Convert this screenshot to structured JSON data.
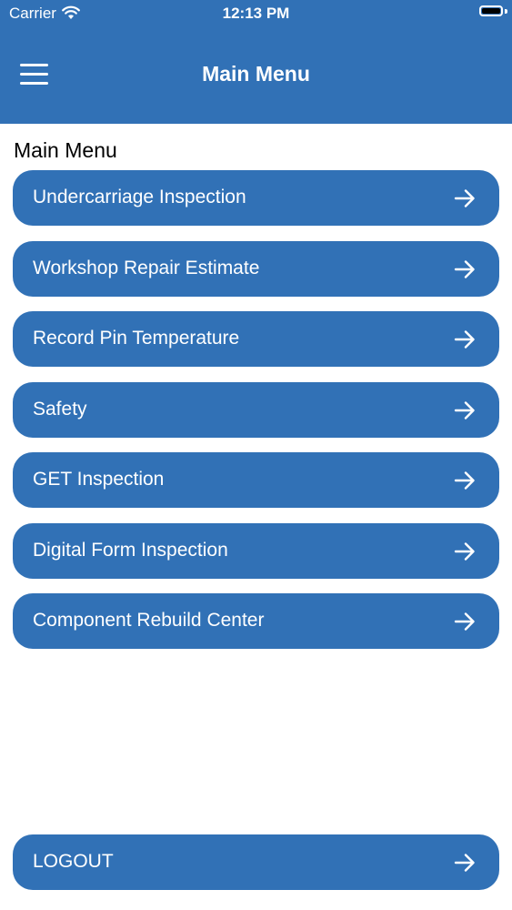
{
  "status_bar": {
    "carrier": "Carrier",
    "time": "12:13 PM",
    "wifi_icon": "wifi-icon",
    "battery_icon": "battery-icon"
  },
  "nav_bar": {
    "title": "Main Menu",
    "menu_icon": "hamburger-icon",
    "color": "#3171b6"
  },
  "main": {
    "section_title": "Main Menu",
    "items": [
      {
        "label": "Undercarriage Inspection",
        "icon": "arrow-right-icon"
      },
      {
        "label": "Workshop Repair Estimate",
        "icon": "arrow-right-icon"
      },
      {
        "label": "Record Pin Temperature",
        "icon": "arrow-right-icon"
      },
      {
        "label": "Safety",
        "icon": "arrow-right-icon"
      },
      {
        "label": "GET Inspection",
        "icon": "arrow-right-icon"
      },
      {
        "label": "Digital Form Inspection",
        "icon": "arrow-right-icon"
      },
      {
        "label": "Component Rebuild Center",
        "icon": "arrow-right-icon"
      }
    ]
  },
  "logout": {
    "label": "LOGOUT",
    "icon": "arrow-right-icon"
  }
}
